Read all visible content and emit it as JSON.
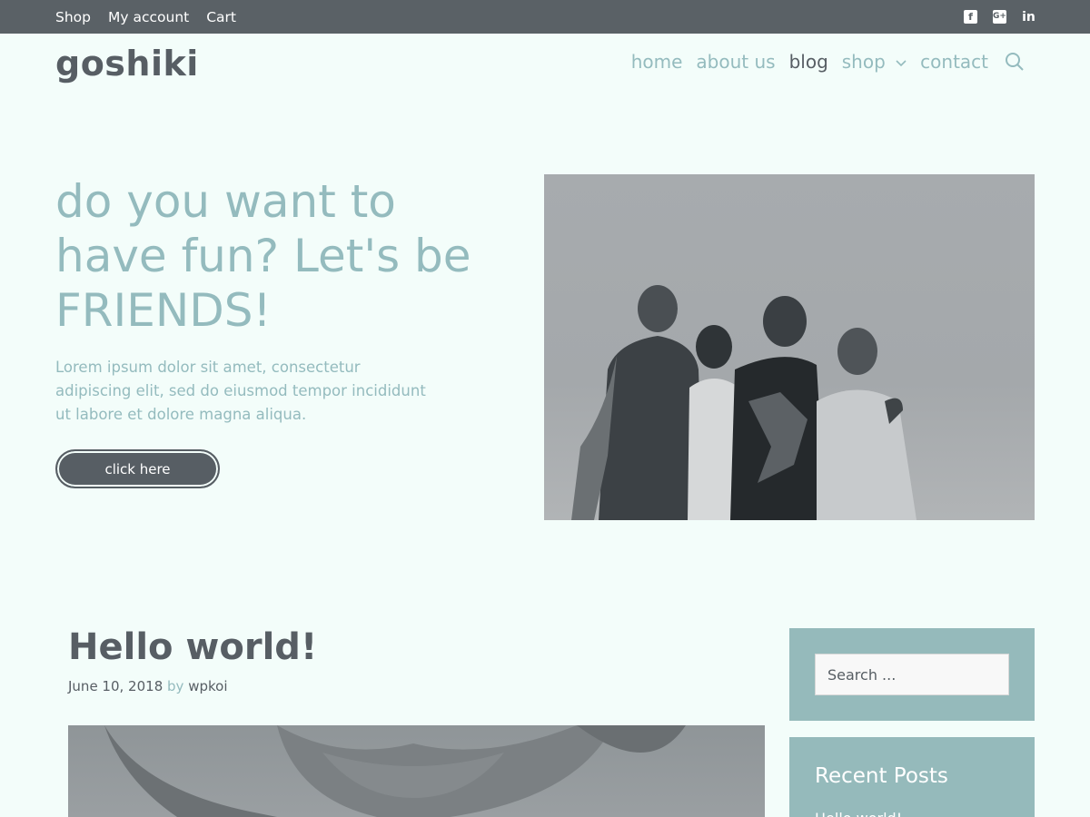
{
  "topbar": {
    "links": [
      "Shop",
      "My account",
      "Cart"
    ],
    "social_icons": [
      "facebook-icon",
      "google-plus-icon",
      "linkedin-icon"
    ]
  },
  "header": {
    "logo": "goshiki",
    "nav": [
      {
        "label": "home"
      },
      {
        "label": "about us"
      },
      {
        "label": "blog",
        "current": true
      },
      {
        "label": "shop",
        "has_submenu": true
      },
      {
        "label": "contact"
      }
    ]
  },
  "hero": {
    "title": "do you want to have fun? Let's be FRIENDS!",
    "text": "Lorem ipsum dolor sit amet, consectetur adipiscing elit, sed do eiusmod tempor incididunt ut labore et dolore magna aliqua.",
    "button_label": "click here"
  },
  "post": {
    "title": "Hello world!",
    "date": "June 10, 2018",
    "by": "by",
    "author": "wpkoi"
  },
  "sidebar": {
    "search_placeholder": "Search ...",
    "recent_posts_title": "Recent Posts",
    "recent_posts": [
      "Hello world!"
    ]
  },
  "colors": {
    "background": "#f3fdfa",
    "topbar": "#5a6166",
    "accent": "#94bbbe",
    "dark": "#575e64"
  }
}
